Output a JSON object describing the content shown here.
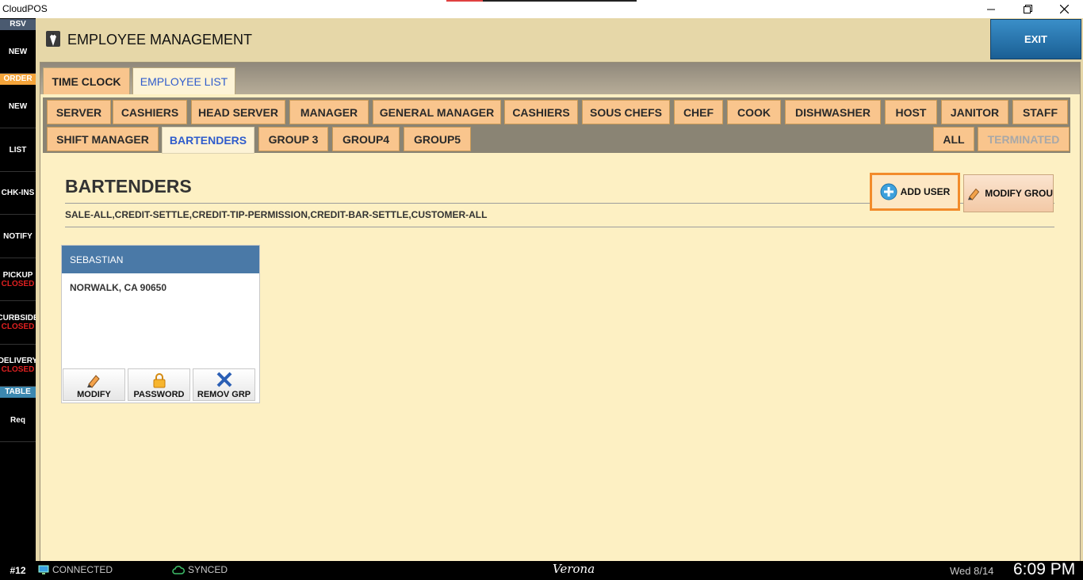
{
  "window": {
    "title": "CloudPOS"
  },
  "sidebar": {
    "labels": {
      "rsv": "RSV",
      "order": "ORDER",
      "table": "TABLE"
    },
    "items": [
      {
        "label": "NEW",
        "status": ""
      },
      {
        "label": "NEW",
        "status": ""
      },
      {
        "label": "LIST",
        "status": ""
      },
      {
        "label": "CHK-INS",
        "status": ""
      },
      {
        "label": "NOTIFY",
        "status": ""
      },
      {
        "label": "PICKUP",
        "status": "CLOSED"
      },
      {
        "label": "CURBSIDE",
        "status": "CLOSED"
      },
      {
        "label": "DELIVERY",
        "status": "CLOSED"
      },
      {
        "label": "Req",
        "status": ""
      }
    ]
  },
  "header": {
    "title": "EMPLOYEE MANAGEMENT",
    "exit_label": "EXIT"
  },
  "top_tabs": [
    {
      "label": "TIME CLOCK",
      "active": false
    },
    {
      "label": "EMPLOYEE LIST",
      "active": true
    }
  ],
  "group_tabs": {
    "row1": [
      "SERVER",
      "CASHIERS",
      "HEAD SERVER",
      "MANAGER",
      "GENERAL MANAGER",
      "CASHIERS",
      "SOUS CHEFS",
      "CHEF",
      "COOK",
      "DISHWASHER",
      "HOST",
      "JANITOR",
      "STAFF"
    ],
    "row2": [
      "SHIFT MANAGER",
      "BARTENDERS",
      "GROUP 3",
      "GROUP4",
      "GROUP5"
    ],
    "right": [
      "ALL",
      "TERMINATED"
    ],
    "active": "BARTENDERS"
  },
  "panel": {
    "group_title": "BARTENDERS",
    "permissions": "SALE-ALL,CREDIT-SETTLE,CREDIT-TIP-PERMISSION,CREDIT-BAR-SETTLE,CUSTOMER-ALL",
    "add_user_label": "ADD USER",
    "modify_group_label": "MODIFY GROU"
  },
  "employees": [
    {
      "name": "SEBASTIAN",
      "address": "NORWALK, CA 90650",
      "actions": [
        "MODIFY",
        "PASSWORD",
        "REMOV GRP"
      ]
    }
  ],
  "statusbar": {
    "station": "#12",
    "connection": "CONNECTED",
    "sync": "SYNCED",
    "store": "Verona",
    "date": "Wed 8/14",
    "time": "6:09 PM"
  },
  "colors": {
    "exit_blue": "#1a5f94",
    "tab_orange": "#f9c58d",
    "active_tab_text": "#2f5ccc",
    "card_header": "#4a79a7",
    "add_user_border": "#f28b2b",
    "closed_red": "#e02020"
  }
}
